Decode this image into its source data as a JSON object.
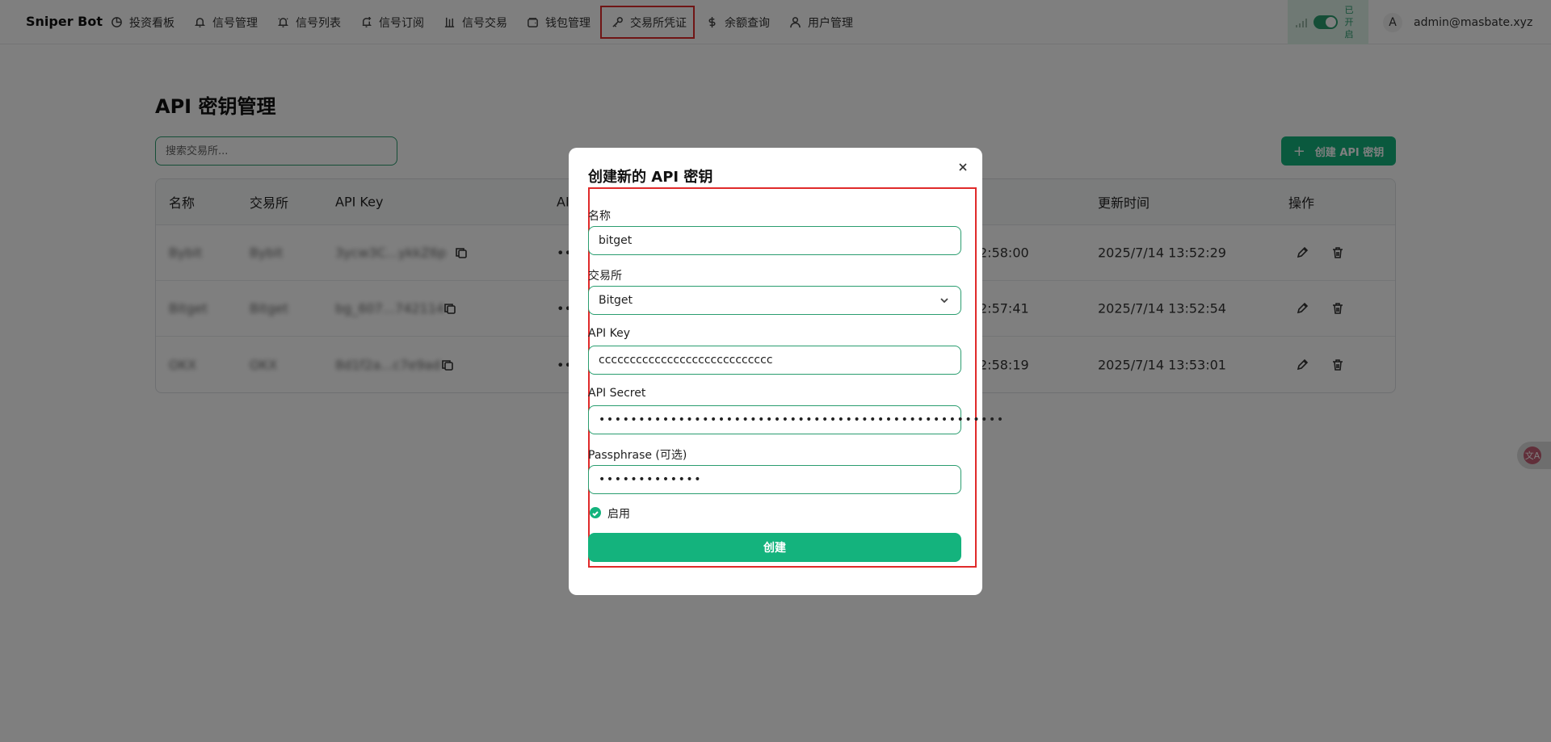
{
  "brand": "Sniper Bot",
  "nav": [
    {
      "label": "投资看板",
      "icon": "pie-chart-icon"
    },
    {
      "label": "信号管理",
      "icon": "bell-icon"
    },
    {
      "label": "信号列表",
      "icon": "bell-ring-icon"
    },
    {
      "label": "信号订阅",
      "icon": "bell-plus-icon"
    },
    {
      "label": "信号交易",
      "icon": "candlestick-icon"
    },
    {
      "label": "钱包管理",
      "icon": "wallet-icon"
    },
    {
      "label": "交易所凭证",
      "icon": "key-icon",
      "active": true
    },
    {
      "label": "余额查询",
      "icon": "dollar-icon"
    },
    {
      "label": "用户管理",
      "icon": "user-icon"
    }
  ],
  "status": {
    "line1": "已",
    "line2": "开",
    "line3": "启"
  },
  "user": {
    "avatar": "A",
    "email": "admin@masbate.xyz"
  },
  "page": {
    "title": "API 密钥管理",
    "search_placeholder": "搜索交易所...",
    "create_button": "创建 API 密钥"
  },
  "table": {
    "headers": [
      "名称",
      "交易所",
      "API Key",
      "AI",
      "更新时间",
      "操作"
    ],
    "rows": [
      {
        "name": "Bybit",
        "exchange": "Bybit",
        "api_key": "3ycw3C...ykkZ6p",
        "secret": "••",
        "created": "2:58:00",
        "updated": "2025/7/14 13:52:29"
      },
      {
        "name": "Bitget",
        "exchange": "Bitget",
        "api_key": "bg_607...742114",
        "secret": "••",
        "created": "2:57:41",
        "updated": "2025/7/14 13:52:54"
      },
      {
        "name": "OKX",
        "exchange": "OKX",
        "api_key": "8d1f2a...c7e9ad",
        "secret": "••",
        "created": "2:58:19",
        "updated": "2025/7/14 13:53:01"
      }
    ]
  },
  "dialog": {
    "title": "创建新的 API 密钥",
    "name_label": "名称",
    "name_value": "bitget",
    "exchange_label": "交易所",
    "exchange_value": "Bitget",
    "api_key_label": "API Key",
    "api_key_value": "cccccccccccccccccccccccccccc",
    "api_secret_label": "API Secret",
    "api_secret_value": "•••••••••••••••••••••••••••••••••••••••••••••••••••",
    "passphrase_label": "Passphrase (可选)",
    "passphrase_value": "•••••••••••••",
    "enabled_label": "启用",
    "submit_label": "创建"
  },
  "float_icon": "文A",
  "colors": {
    "accent": "#14b37d",
    "highlight": "#e02a2a"
  }
}
